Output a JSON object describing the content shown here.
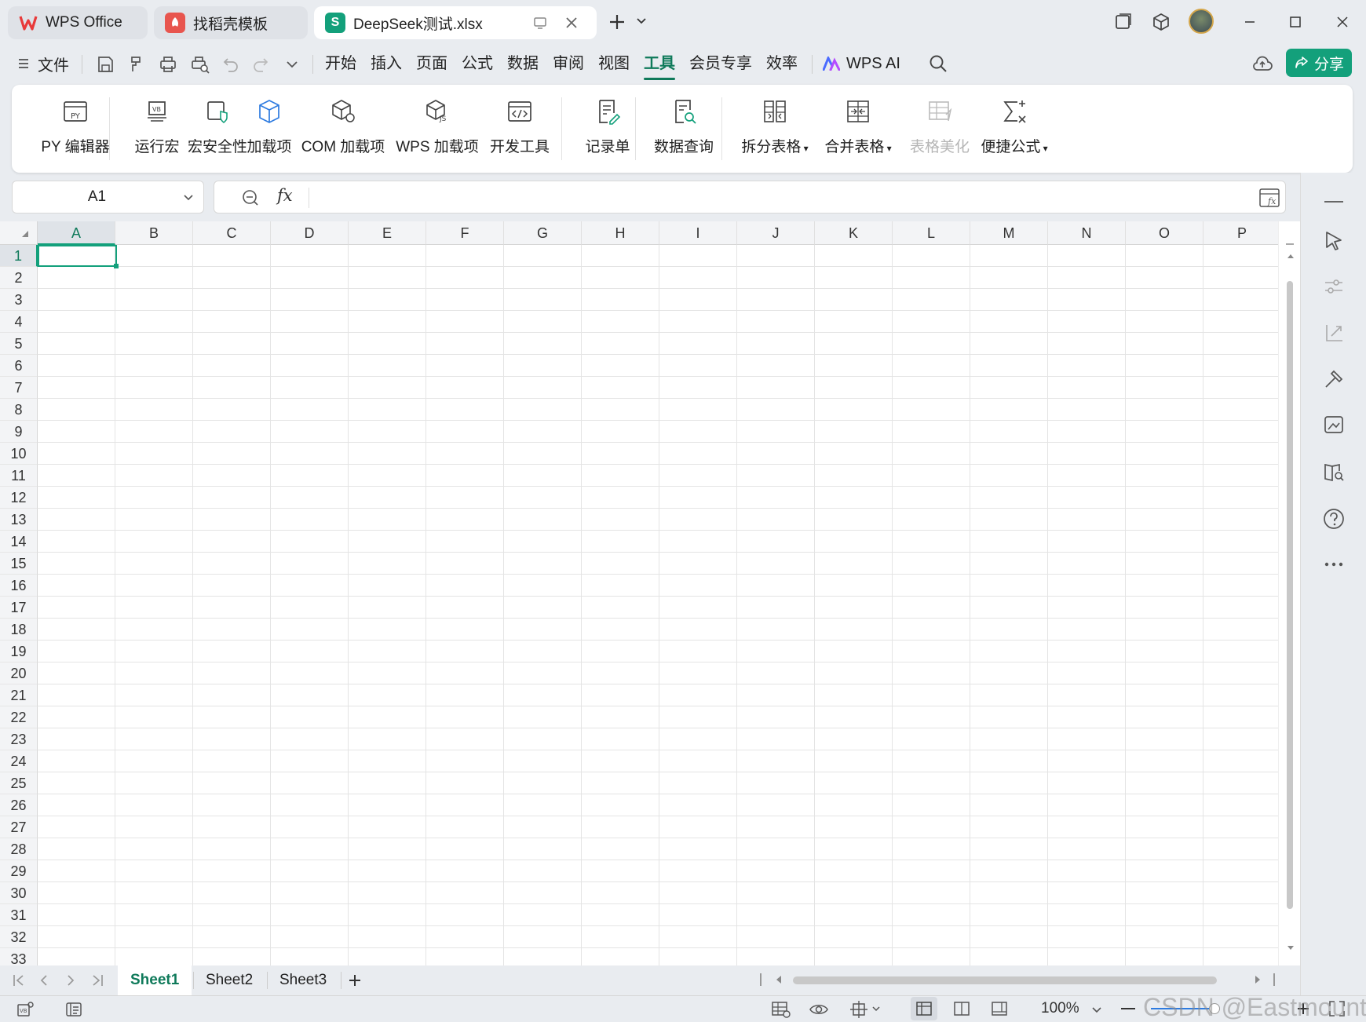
{
  "tabs": [
    {
      "label": "WPS Office",
      "icon": "wps-logo-icon",
      "state": "inactive"
    },
    {
      "label": "找稻壳模板",
      "icon": "docer-icon",
      "state": "inactive"
    },
    {
      "label": "DeepSeek测试.xlsx",
      "icon": "spreadsheet-S-icon",
      "state": "active"
    }
  ],
  "menu": {
    "file_label": "文件",
    "items": [
      "开始",
      "插入",
      "页面",
      "公式",
      "数据",
      "审阅",
      "视图",
      "工具",
      "会员专享",
      "效率"
    ],
    "active": "工具",
    "ai_label": "WPS AI",
    "share_label": "分享"
  },
  "ribbon": [
    {
      "label": "PY 编辑器",
      "icon": "py-editor-icon"
    },
    {
      "label": "运行宏",
      "icon": "run-macro-icon"
    },
    {
      "label": "宏安全性",
      "icon": "macro-security-icon"
    },
    {
      "label": "加载项",
      "icon": "addin-cube-icon"
    },
    {
      "label": "COM 加载项",
      "icon": "com-addin-icon"
    },
    {
      "label": "WPS 加载项",
      "icon": "wps-addin-icon"
    },
    {
      "label": "开发工具",
      "icon": "dev-tools-icon"
    },
    {
      "label": "记录单",
      "icon": "record-form-icon"
    },
    {
      "label": "数据查询",
      "icon": "data-query-icon"
    },
    {
      "label": "拆分表格",
      "icon": "split-table-icon"
    },
    {
      "label": "合并表格",
      "icon": "merge-table-icon"
    },
    {
      "label": "表格美化",
      "icon": "beautify-table-icon",
      "disabled": true
    },
    {
      "label": "便捷公式",
      "icon": "quick-formula-icon"
    }
  ],
  "namebox": {
    "value": "A1"
  },
  "formula": {
    "fx_label": "fx",
    "value": ""
  },
  "columns": [
    "A",
    "B",
    "C",
    "D",
    "E",
    "F",
    "G",
    "H",
    "I",
    "J",
    "K",
    "L",
    "M",
    "N",
    "O",
    "P"
  ],
  "rows": [
    "1",
    "2",
    "3",
    "4",
    "5",
    "6",
    "7",
    "8",
    "9",
    "10",
    "11",
    "12",
    "13",
    "14",
    "15",
    "16",
    "17",
    "18",
    "19",
    "20",
    "21",
    "22",
    "23",
    "24",
    "25",
    "26",
    "27",
    "28",
    "29",
    "30",
    "31",
    "32",
    "33"
  ],
  "selected_cell": "A1",
  "sheets": [
    "Sheet1",
    "Sheet2",
    "Sheet3"
  ],
  "active_sheet": "Sheet1",
  "status": {
    "zoom": "100%"
  },
  "watermark": "CSDN @Eastmount",
  "colors": {
    "accent": "#0f7a5a",
    "share_btn": "#13a07b",
    "wps_red": "#e83a3a"
  }
}
